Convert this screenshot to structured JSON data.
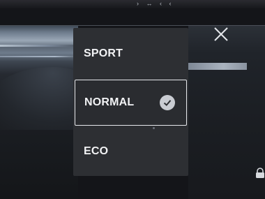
{
  "status_bar": {
    "glyphs": "› ↔ ‹ ‹"
  },
  "mode_menu": {
    "options": [
      {
        "label": "SPORT",
        "selected": false
      },
      {
        "label": "NORMAL",
        "selected": true
      },
      {
        "label": "ECO",
        "selected": false
      }
    ]
  },
  "icons": {
    "close": "close-icon",
    "check": "check-icon",
    "lock": "lock-icon"
  },
  "colors": {
    "menu_background": "#2d2f33",
    "selected_border": "#e6e8ec",
    "text": "#f2f3f5"
  }
}
